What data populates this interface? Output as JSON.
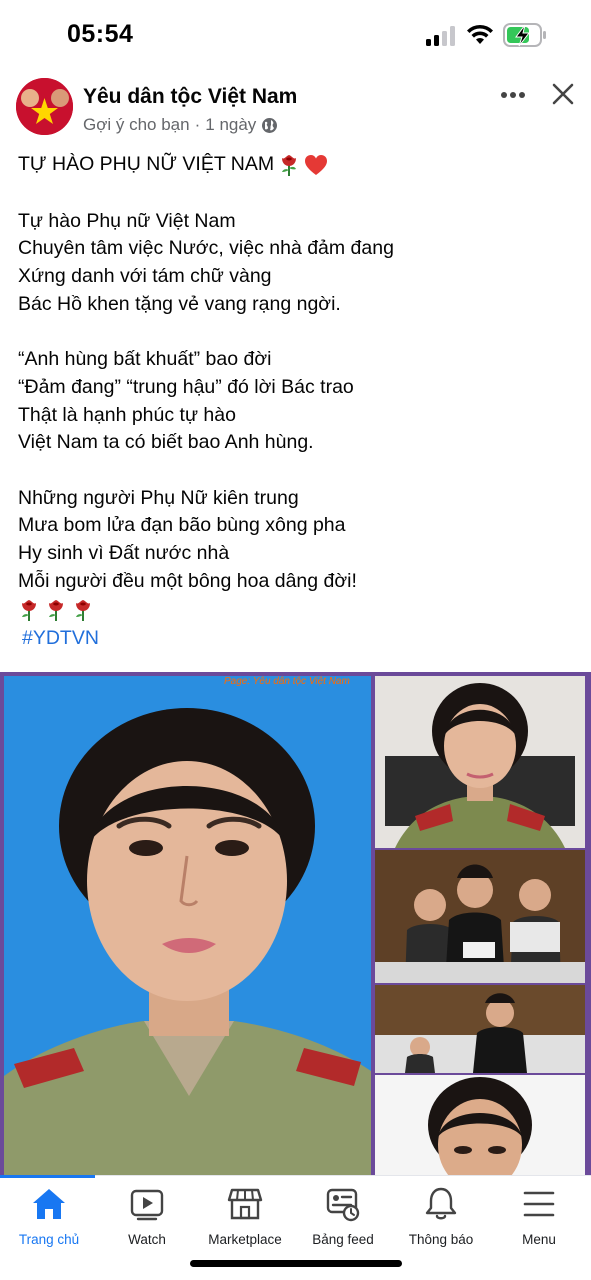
{
  "status_bar": {
    "time": "05:54",
    "icons": [
      "cellular-signal-icon",
      "wifi-icon",
      "battery-charging-icon"
    ]
  },
  "post": {
    "page_name": "Yêu dân tộc Việt Nam",
    "meta_suggested": "Gợi ý cho bạn",
    "meta_separator": "·",
    "meta_time": "1 ngày",
    "privacy_icon": "globe-icon",
    "title": "TỰ HÀO PHỤ NỮ VIỆT NAM",
    "title_emojis": [
      "rose",
      "red-heart"
    ],
    "stanzas": [
      [
        "Tự hào Phụ nữ Việt Nam",
        "Chuyên tâm việc Nước, việc nhà đảm đang",
        "Xứng danh với tám chữ vàng",
        "Bác Hồ khen tặng vẻ vang rạng ngời."
      ],
      [
        "“Anh hùng bất khuất” bao đời",
        "“Đảm đang” “trung hậu” đó lời Bác trao",
        "Thật là hạnh phúc tự hào",
        "Việt Nam ta có biết bao Anh hùng."
      ],
      [
        "Những người Phụ Nữ kiên trung",
        "Mưa bom lửa đạn bão bùng xông pha",
        "Hy sinh vì Đất nước nhà",
        "Mỗi người đều một bông hoa dâng đời!"
      ]
    ],
    "closing_emojis": [
      "rose",
      "rose",
      "rose"
    ],
    "hashtag": "#YDTVN",
    "image_watermark": "Page: Yêu dân tộc Việt Nam"
  },
  "tab_bar": {
    "tabs": [
      {
        "label": "Trang chủ",
        "icon": "home-icon",
        "active": true
      },
      {
        "label": "Watch",
        "icon": "watch-video-icon",
        "active": false
      },
      {
        "label": "Marketplace",
        "icon": "marketplace-store-icon",
        "active": false
      },
      {
        "label": "Bảng feed",
        "icon": "feeds-icon",
        "active": false
      },
      {
        "label": "Thông báo",
        "icon": "bell-icon",
        "active": false
      },
      {
        "label": "Menu",
        "icon": "hamburger-menu-icon",
        "active": false
      }
    ]
  },
  "colors": {
    "accent": "#1877f2",
    "hashtag": "#216fdb",
    "meta_text": "#65676b",
    "collage_border": "#6b4a9a",
    "main_photo_background": "#2a8ee0",
    "watermark": "#ff6a00"
  }
}
